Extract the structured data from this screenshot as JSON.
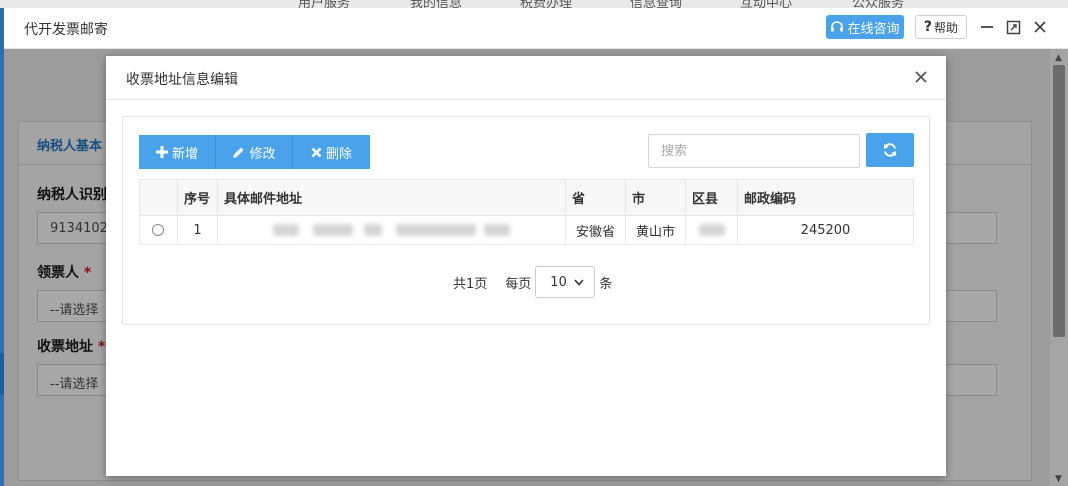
{
  "window": {
    "title": "代开发票邮寄",
    "consult_label": "在线咨询",
    "help_label": "帮助"
  },
  "nav_tabs": [
    "用户服务",
    "我的信息",
    "税费办理",
    "信息查询",
    "互动中心",
    "公众服务"
  ],
  "background_form": {
    "section_title": "纳税人基本",
    "labels": [
      "纳税人识别",
      "领票人",
      "收票地址"
    ],
    "taxpayer_id_value": "9134102",
    "receiver_placeholder": "--请选择",
    "address_placeholder": "--请选择"
  },
  "modal": {
    "title": "收票地址信息编辑",
    "toolbar": {
      "add_label": "新增",
      "edit_label": "修改",
      "delete_label": "删除"
    },
    "search": {
      "placeholder": "搜索",
      "value": ""
    },
    "table": {
      "columns": [
        "",
        "序号",
        "具体邮件地址",
        "省",
        "市",
        "区县",
        "邮政编码"
      ],
      "rows": [
        {
          "index": "1",
          "address": "",
          "province": "安徽省",
          "city": "黄山市",
          "county": "",
          "postcode": "245200"
        }
      ]
    },
    "pager": {
      "total_pages": "共1页",
      "per_page_prefix": "每页",
      "page_size": "10",
      "per_page_suffix": "条"
    }
  },
  "colors": {
    "accent": "#4aa3ea",
    "title_blue": "#1b4f80"
  }
}
